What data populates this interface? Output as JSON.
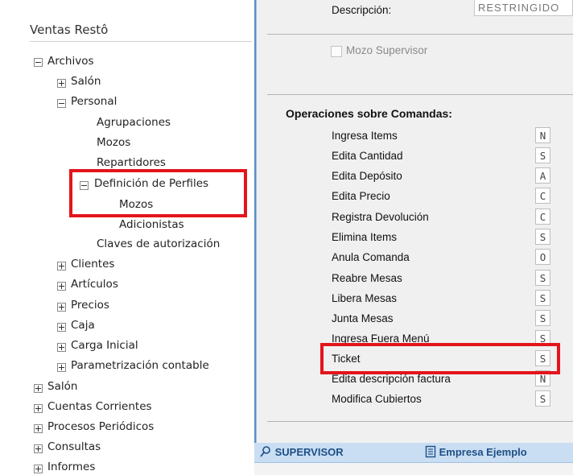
{
  "app_title": "Ventas Restô",
  "tree": [
    {
      "label": "Archivos",
      "state": "expanded"
    },
    {
      "label": "Salón",
      "state": "collapsed"
    },
    {
      "label": "Personal",
      "state": "expanded"
    },
    {
      "label": "Agrupaciones",
      "state": "leaf"
    },
    {
      "label": "Mozos",
      "state": "leaf"
    },
    {
      "label": "Repartidores",
      "state": "leaf"
    },
    {
      "label": "Definición de Perfiles",
      "state": "expanded"
    },
    {
      "label": "Mozos",
      "state": "leaf"
    },
    {
      "label": "Adicionistas",
      "state": "leaf"
    },
    {
      "label": "Claves de autorización",
      "state": "leaf"
    },
    {
      "label": "Clientes",
      "state": "collapsed"
    },
    {
      "label": "Artículos",
      "state": "collapsed"
    },
    {
      "label": "Precios",
      "state": "collapsed"
    },
    {
      "label": "Caja",
      "state": "collapsed"
    },
    {
      "label": "Carga Inicial",
      "state": "collapsed"
    },
    {
      "label": "Parametrización contable",
      "state": "collapsed"
    },
    {
      "label": "Salón",
      "state": "collapsed"
    },
    {
      "label": "Cuentas Corrientes",
      "state": "collapsed"
    },
    {
      "label": "Procesos Periódicos",
      "state": "collapsed"
    },
    {
      "label": "Consultas",
      "state": "collapsed"
    },
    {
      "label": "Informes",
      "state": "collapsed"
    }
  ],
  "form": {
    "descripcion_label": "Descripción:",
    "descripcion_value": "RESTRINGIDO",
    "checkbox_label": "Mozo  Supervisor",
    "checkbox_checked": false,
    "section_title": "Operaciones sobre Comandas:"
  },
  "operations": [
    {
      "label": "Ingresa Items",
      "value": "N"
    },
    {
      "label": "Edita Cantidad",
      "value": "S"
    },
    {
      "label": "Edita Depósito",
      "value": "A"
    },
    {
      "label": "Edita Precio",
      "value": "C"
    },
    {
      "label": "Registra Devolución",
      "value": "C"
    },
    {
      "label": "Elimina Items",
      "value": "S"
    },
    {
      "label": "Anula Comanda",
      "value": "O"
    },
    {
      "label": "Reabre Mesas",
      "value": "S"
    },
    {
      "label": "Libera Mesas",
      "value": "S"
    },
    {
      "label": "Junta Mesas",
      "value": "S"
    },
    {
      "label": "Ingresa Fuera Menú",
      "value": "S"
    },
    {
      "label": "Ticket",
      "value": "S"
    },
    {
      "label": "Edita descripción factura",
      "value": "N"
    },
    {
      "label": "Modifica Cubiertos",
      "value": "S"
    }
  ],
  "status": {
    "user": "SUPERVISOR",
    "company": "Empresa Ejemplo",
    "user_icon": "user-search-icon",
    "company_icon": "building-icon"
  },
  "colors": {
    "highlight": "#e4141b",
    "status_bg": "#c9def3",
    "status_text": "#1f4f85"
  }
}
